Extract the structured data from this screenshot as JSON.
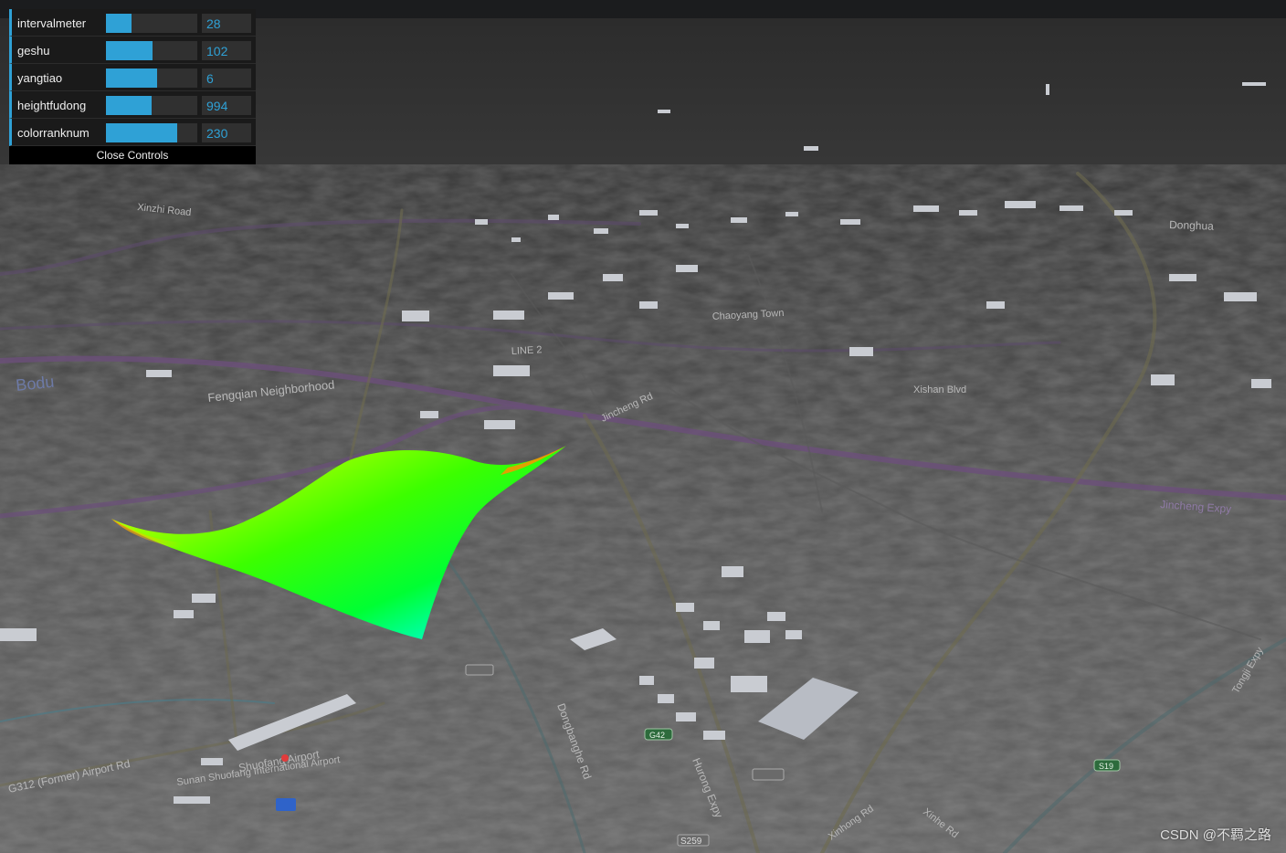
{
  "gui": {
    "controls": [
      {
        "label": "intervalmeter",
        "value": "28",
        "fill": 0.28
      },
      {
        "label": "geshu",
        "value": "102",
        "fill": 0.51
      },
      {
        "label": "yangtiao",
        "value": "6",
        "fill": 0.56
      },
      {
        "label": "heightfudong",
        "value": "994",
        "fill": 0.5
      },
      {
        "label": "colorranknum",
        "value": "230",
        "fill": 0.78
      }
    ],
    "close_label": "Close Controls"
  },
  "map": {
    "labels": [
      "Fengqian Neighborhood",
      "Bodu",
      "LINE 2",
      "Jincheng Expy",
      "Chaoyang Town",
      "Xinzhi Road",
      "Donghua",
      "Xishan Blvd",
      "Shuofang Airport",
      "Sunan Shuofang International Airport",
      "G312 (Former) Airport Rd",
      "Dongbanghe Rd",
      "Hurong Expy",
      "S259",
      "Xinhong Rd",
      "Xinhe Rd",
      "Tongji Expy",
      "Jincheng Rd",
      "G42",
      "S19"
    ]
  },
  "watermark": "CSDN @不羁之路",
  "colors": {
    "accent": "#2fa1d6",
    "panel_bg": "#1a1a1a",
    "slider_bg": "#303030",
    "sky": "#1c1d1f",
    "ground": "#5a5a5a"
  }
}
